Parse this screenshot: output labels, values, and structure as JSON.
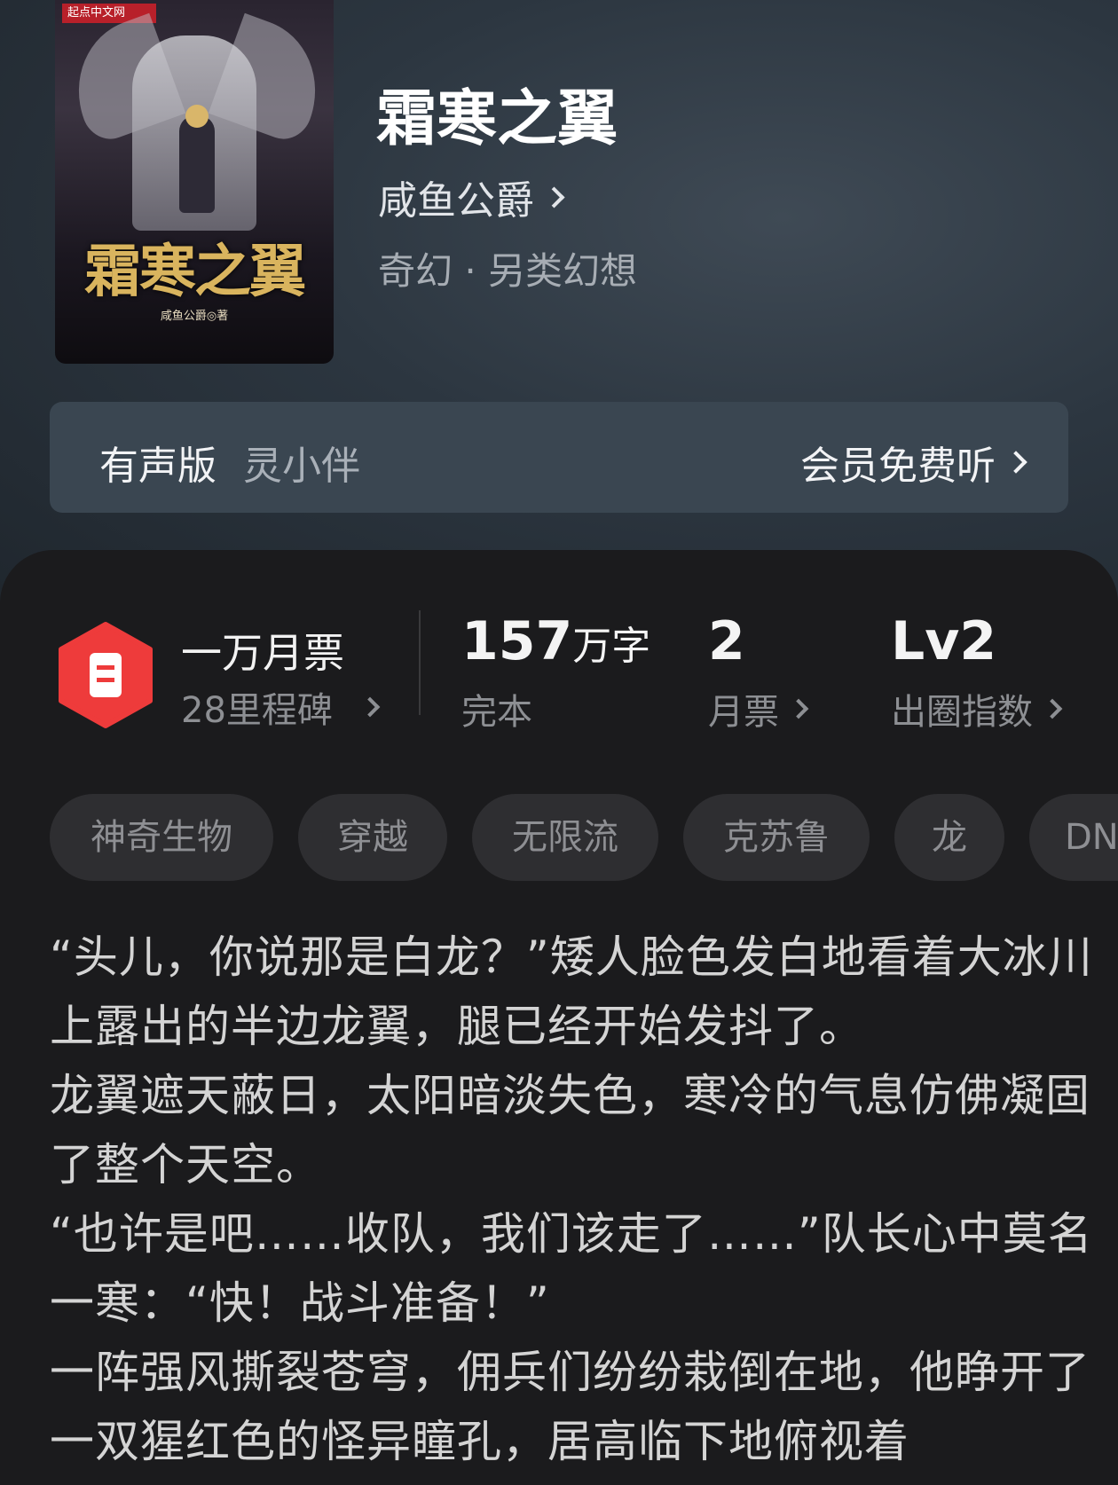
{
  "book": {
    "title": "霜寒之翼",
    "author": "咸鱼公爵",
    "genre": "奇幻 · 另类幻想",
    "cover": {
      "badge": "起点中文网",
      "title": "霜寒之翼",
      "author": "咸鱼公爵◎著"
    }
  },
  "audio": {
    "label": "有声版",
    "narrator": "灵小伴",
    "action": "会员免费听"
  },
  "milestone": {
    "title": "一万月票",
    "subtitle": "28里程碑"
  },
  "stats": [
    {
      "value": "157",
      "unit": "万字",
      "label": "完本"
    },
    {
      "value": "2",
      "unit": "",
      "label": "月票"
    },
    {
      "value": "Lv2",
      "unit": "",
      "label": "出圈指数"
    }
  ],
  "tags": [
    "神奇生物",
    "穿越",
    "无限流",
    "克苏鲁",
    "龙",
    "DN"
  ],
  "intro": [
    "“头儿，你说那是白龙？”矮人脸色发白地看着大冰川上露出的半边龙翼，腿已经开始发抖了。",
    "龙翼遮天蔽日，太阳暗淡失色，寒冷的气息仿佛凝固了整个天空。",
    "“也许是吧……收队，我们该走了……”队长心中莫名一寒：“快！战斗准备！”",
    "一阵强风撕裂苍穹，佣兵们纷纷栽倒在地，他睁开了一双猩红色的怪异瞳孔，居高临下地俯视着"
  ],
  "colors": {
    "milestone_red": "#ee3b3b",
    "panel_bg": "#1b1b1d",
    "hero_bg": "#2c3640"
  }
}
